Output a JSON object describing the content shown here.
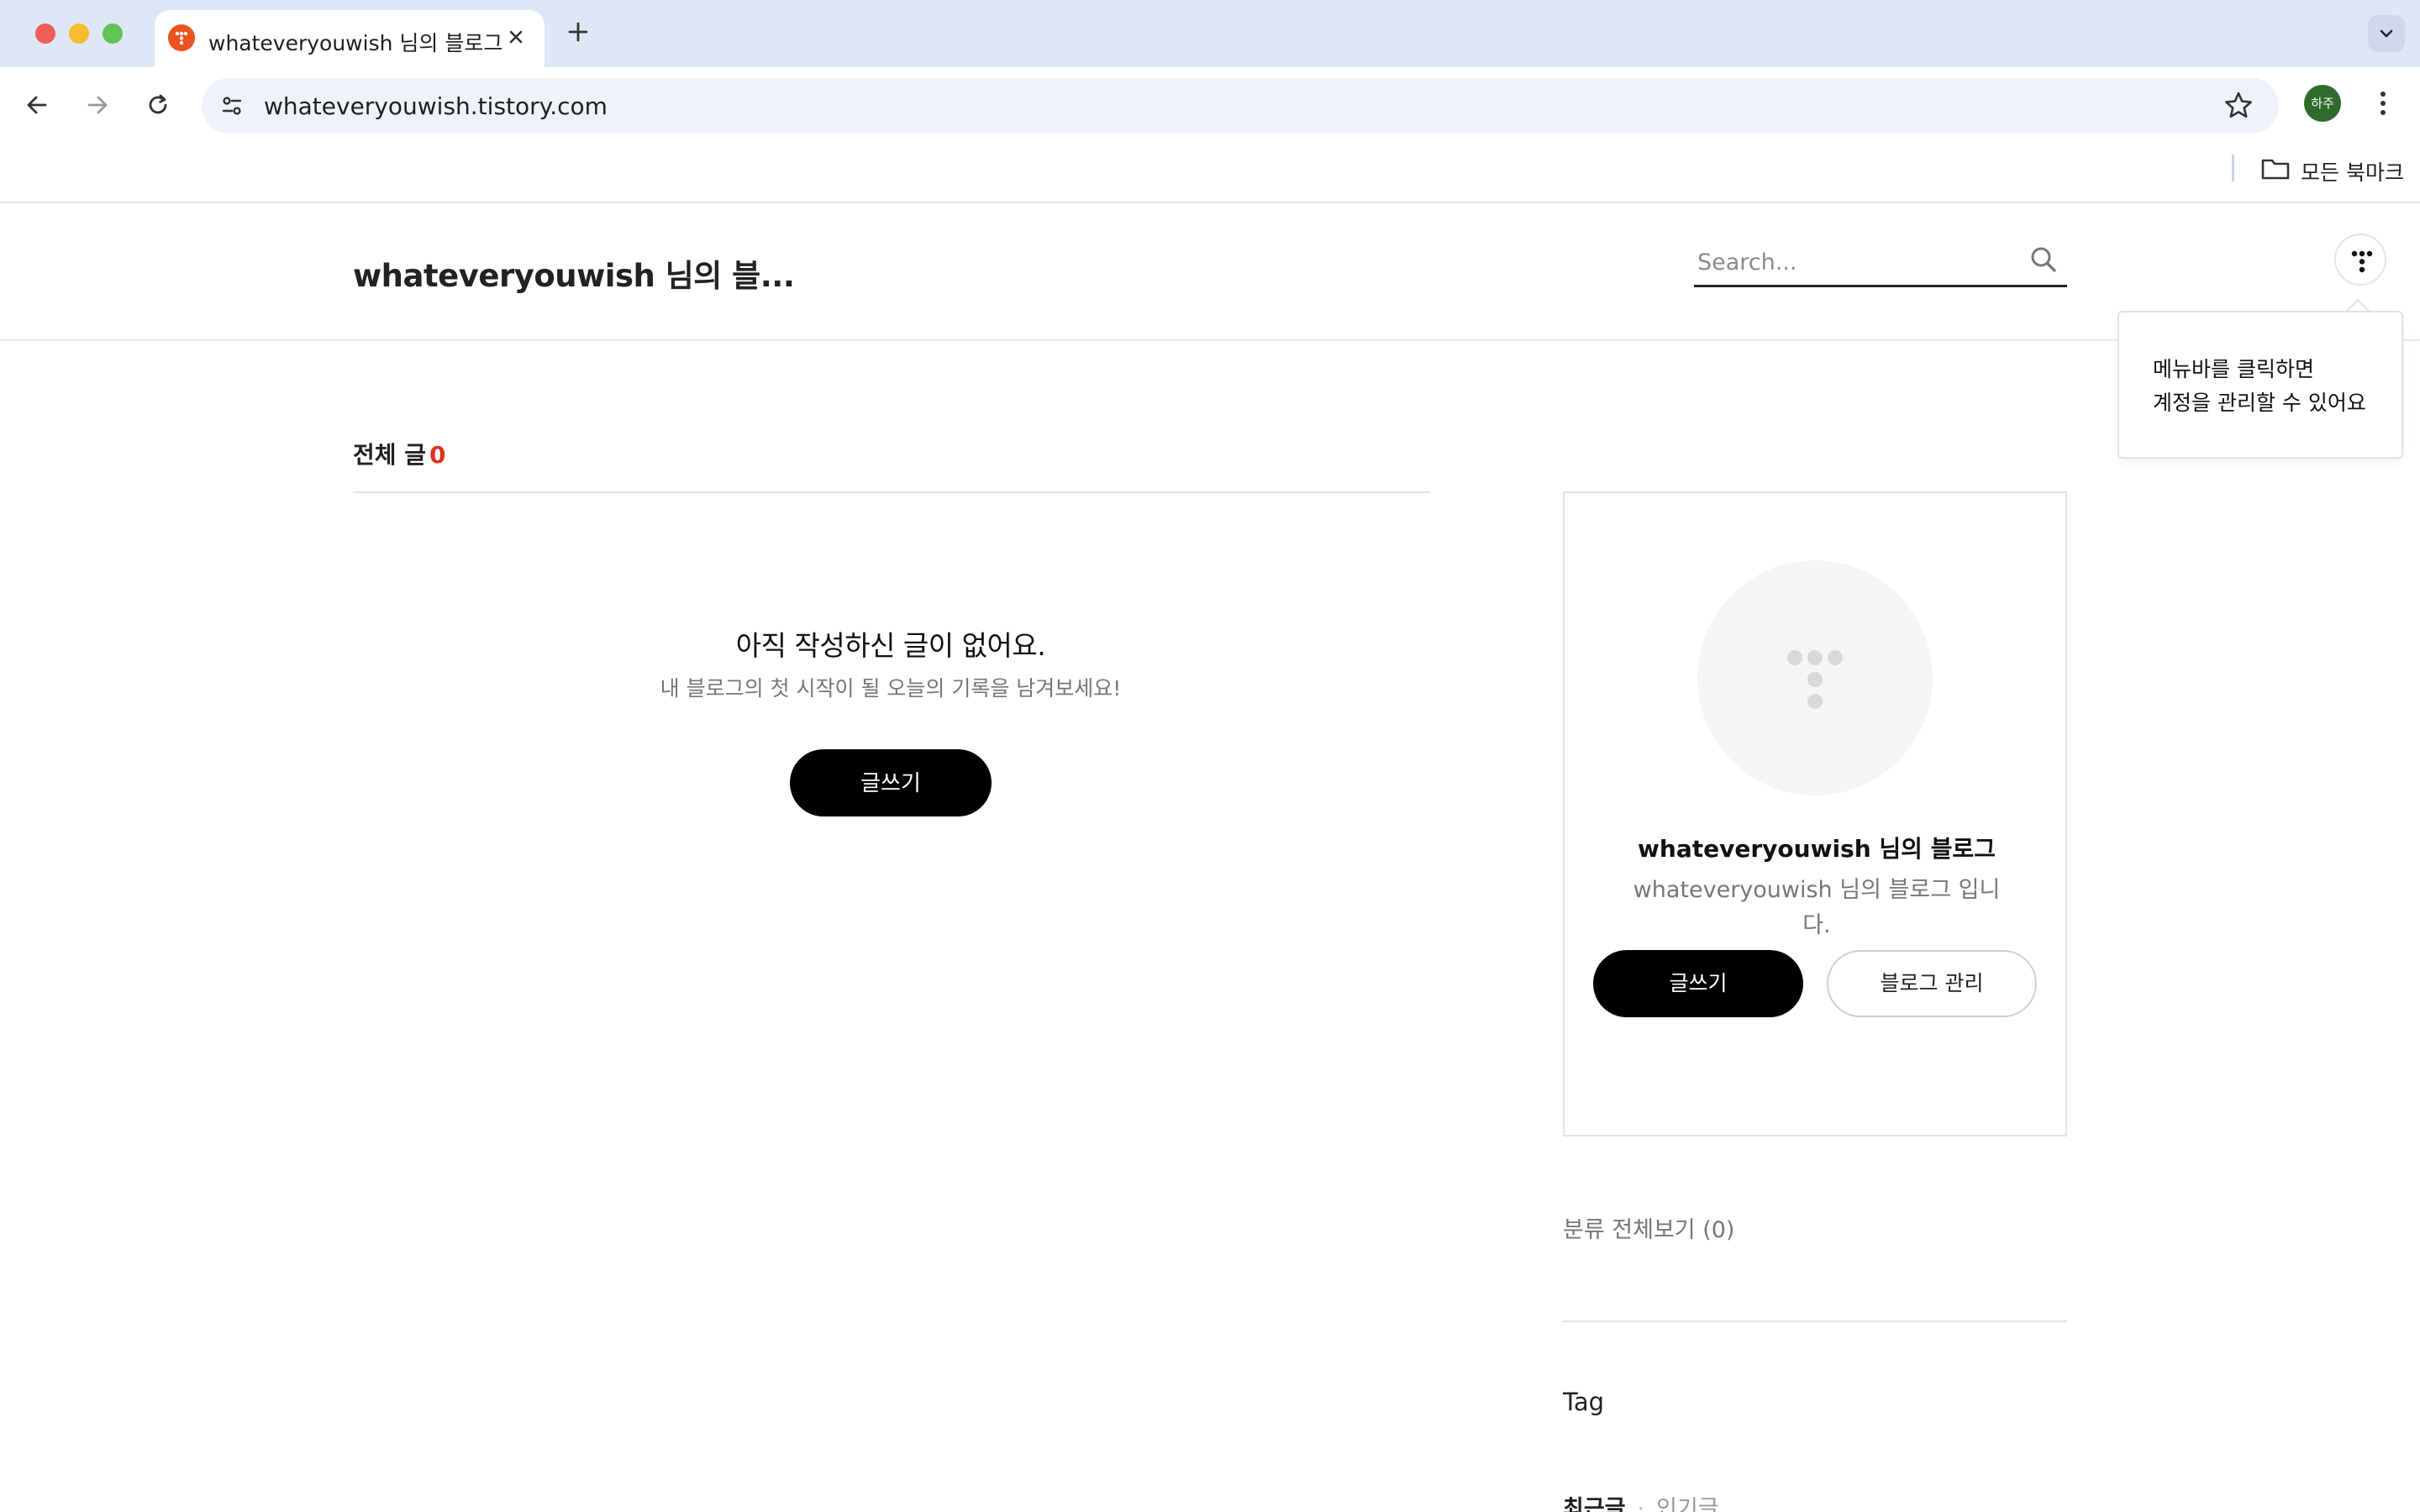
{
  "browser": {
    "tab_title": "whateveryouwish 님의 블로그",
    "url": "whateveryouwish.tistory.com",
    "profile_initials": "하주",
    "bookmarks_all": "모든 북마크",
    "accent_color": "#eb531f"
  },
  "header": {
    "blog_title": "whateveryouwish 님의 블...",
    "search_placeholder": "Search..."
  },
  "tooltip": {
    "text": "메뉴바를 클릭하면\n계정을 관리할 수 있어요"
  },
  "main": {
    "total_label": "전체 글",
    "total_count": "0",
    "empty_title": "아직 작성하신 글이 없어요.",
    "empty_subtitle": "내 블로그의 첫 시작이 될 오늘의 기록을 남겨보세요!",
    "write_button": "글쓰기"
  },
  "sidebar": {
    "blog_name": "whateveryouwish 님의 블로그",
    "blog_description": "whateveryouwish 님의 블로그 입니다.",
    "write_button": "글쓰기",
    "manage_button": "블로그 관리",
    "category_label": "분류 전체보기 (0)",
    "tag_heading": "Tag",
    "recent_tab": "최근글",
    "popular_tab": "인기글"
  }
}
